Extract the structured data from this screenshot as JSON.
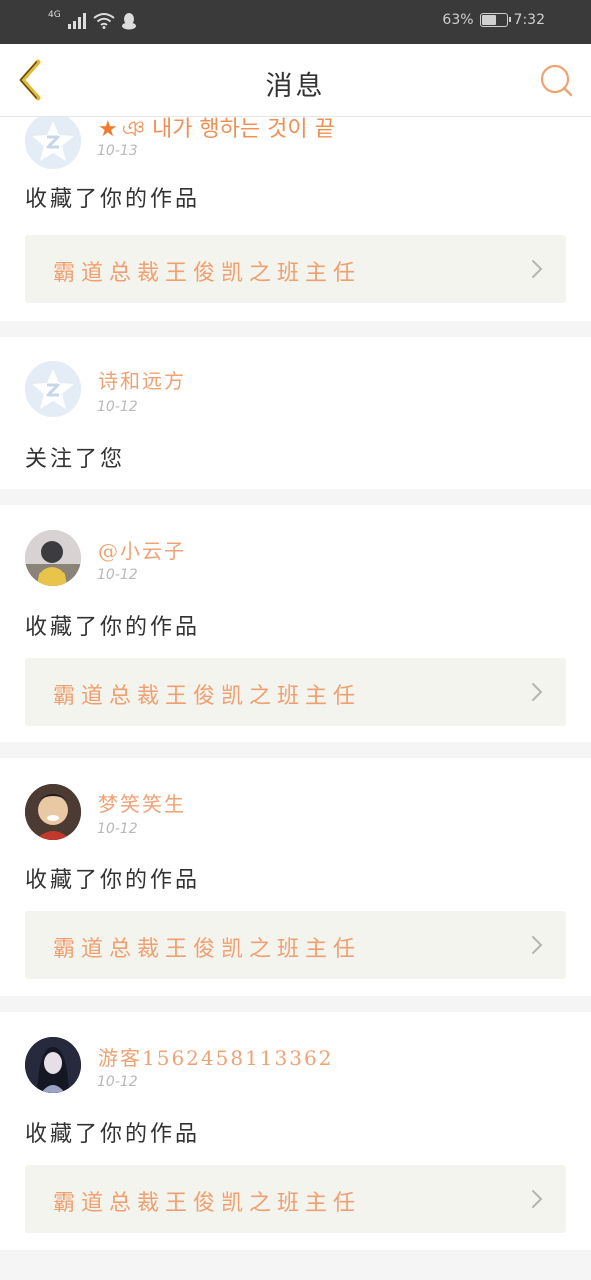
{
  "status_bar": {
    "network": "4G",
    "battery_percent_text": "63%",
    "battery_level": 0.63,
    "time": "7:32"
  },
  "header": {
    "title": "消息",
    "back_icon": "chevron-left-icon",
    "search_icon": "search-icon"
  },
  "colors": {
    "accent": "#f0a274",
    "work_bg": "#f4f4ee",
    "back": "#e8b830"
  },
  "messages": [
    {
      "user": "ঞ 내가 행하는 것이 끝",
      "date": "10-13",
      "action": "收藏了你的作品",
      "work": "霸道总裁王俊凯之班主任"
    },
    {
      "user": "诗和远方",
      "date": "10-12",
      "action": "关注了您",
      "work": ""
    },
    {
      "user": "@小云子",
      "date": "10-12",
      "action": "收藏了你的作品",
      "work": "霸道总裁王俊凯之班主任"
    },
    {
      "user": "梦笑笑生",
      "date": "10-12",
      "action": "收藏了你的作品",
      "work": "霸道总裁王俊凯之班主任"
    },
    {
      "user": "游客1562458113362",
      "date": "10-12",
      "action": "收藏了你的作品",
      "work": "霸道总裁王俊凯之班主任"
    }
  ]
}
